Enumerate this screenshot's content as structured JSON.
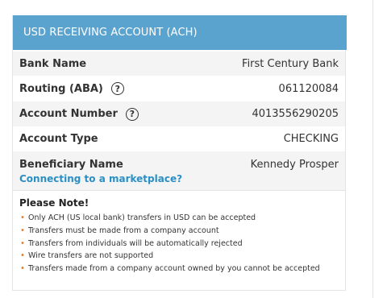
{
  "header": {
    "title": "USD RECEIVING ACCOUNT (ACH)"
  },
  "rows": [
    {
      "label": "Bank Name",
      "value": "First Century Bank"
    },
    {
      "label": "Routing (ABA)",
      "value": "061120084",
      "help_icon": "question-mark"
    },
    {
      "label": "Account Number",
      "value": "4013556290205",
      "help_icon": "question-mark"
    },
    {
      "label": "Account Type",
      "value": "CHECKING"
    },
    {
      "label": "Beneficiary Name",
      "value": "Kennedy Prosper"
    }
  ],
  "help_glyph": "?",
  "marketplace_link": "Connecting to a marketplace?",
  "note": {
    "title": "Please Note!",
    "bullet": "•",
    "items": [
      "Only ACH (US local bank) transfers in USD can be accepted",
      "Transfers must be made from a company account",
      "Transfers from individuals will be automatically rejected",
      "Wire transfers are not supported",
      "Transfers made from a company account owned by you cannot be accepted"
    ]
  },
  "colors": {
    "header_bg": "#5ba3cf",
    "link": "#2a8fc4",
    "bullet": "#e07a2e",
    "row_shade": "#f4f4f4"
  }
}
